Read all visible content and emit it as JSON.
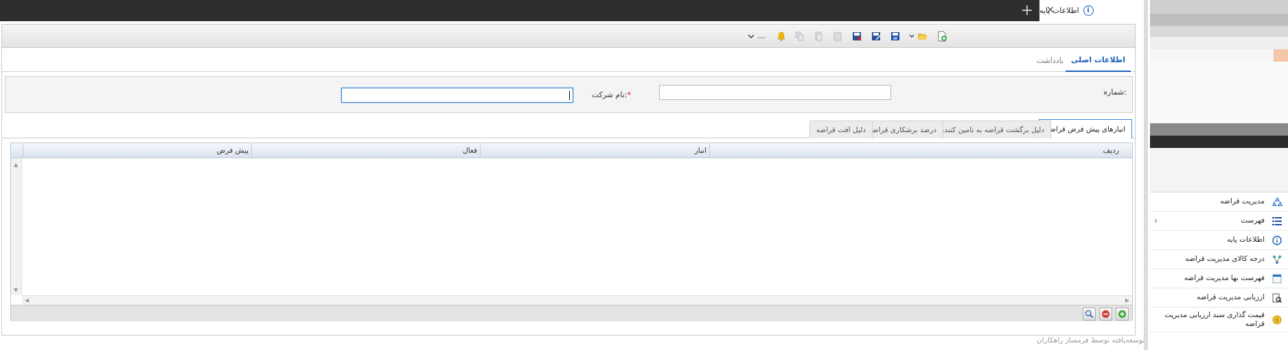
{
  "window": {
    "tab_title": "اطلاعات پایه",
    "icons": {
      "info": "info-icon",
      "close": "close-icon",
      "add": "plus-icon"
    }
  },
  "toolbar": {
    "more_label": "...",
    "icons": [
      "new-icon",
      "open-folder-icon",
      "save-icon",
      "save-as-icon",
      "save-close-icon",
      "paste-icon",
      "copy-icon",
      "cut-icon",
      "bell-icon",
      "chevron-down-icon"
    ]
  },
  "subtabs": [
    {
      "label": "اطلاعات اصلی",
      "active": true
    },
    {
      "label": "یادداشت",
      "active": false
    }
  ],
  "form": {
    "number_label": "شماره:",
    "number_value": "",
    "company_label": "نام شرکت:",
    "company_required": "*",
    "company_value": ""
  },
  "grid_tabs": [
    {
      "label": "انبارهای پیش فرض قراضه",
      "active": true
    },
    {
      "label": "دلیل برگشت قراضه به تامین کننده",
      "active": false
    },
    {
      "label": "درصد برشکاری قراضه",
      "active": false
    },
    {
      "label": "دلیل افت قراضه",
      "active": false
    }
  ],
  "grid": {
    "columns": [
      "ردیف",
      "انبار",
      "فعال",
      "پیش فرض"
    ],
    "rows": []
  },
  "footer": {
    "text": "توسعه‌یافته توسط فرمساز راهکاران"
  },
  "nav": {
    "header": "مدیریت قراضه",
    "items": [
      {
        "label": "فهرست",
        "icon": "list-icon"
      },
      {
        "label": "اطلاعات پایه",
        "icon": "info-icon"
      },
      {
        "label": "درجه کالای مدیریت قراضه",
        "icon": "grade-icon"
      },
      {
        "label": "فهرست بها مدیریت قراضه",
        "icon": "price-list-icon"
      },
      {
        "label": "ارزیابی مدیریت قراضه",
        "icon": "evaluation-icon"
      },
      {
        "label": "قیمت گذاری سند ارزیابی مدیریت قراضه",
        "icon": "coin-icon"
      }
    ]
  },
  "colors": {
    "accent": "#1a5fb4",
    "topbar": "#2e2e2e",
    "required": "#dd0000",
    "add_green": "#3aa43a",
    "remove_red": "#d23a3a"
  }
}
